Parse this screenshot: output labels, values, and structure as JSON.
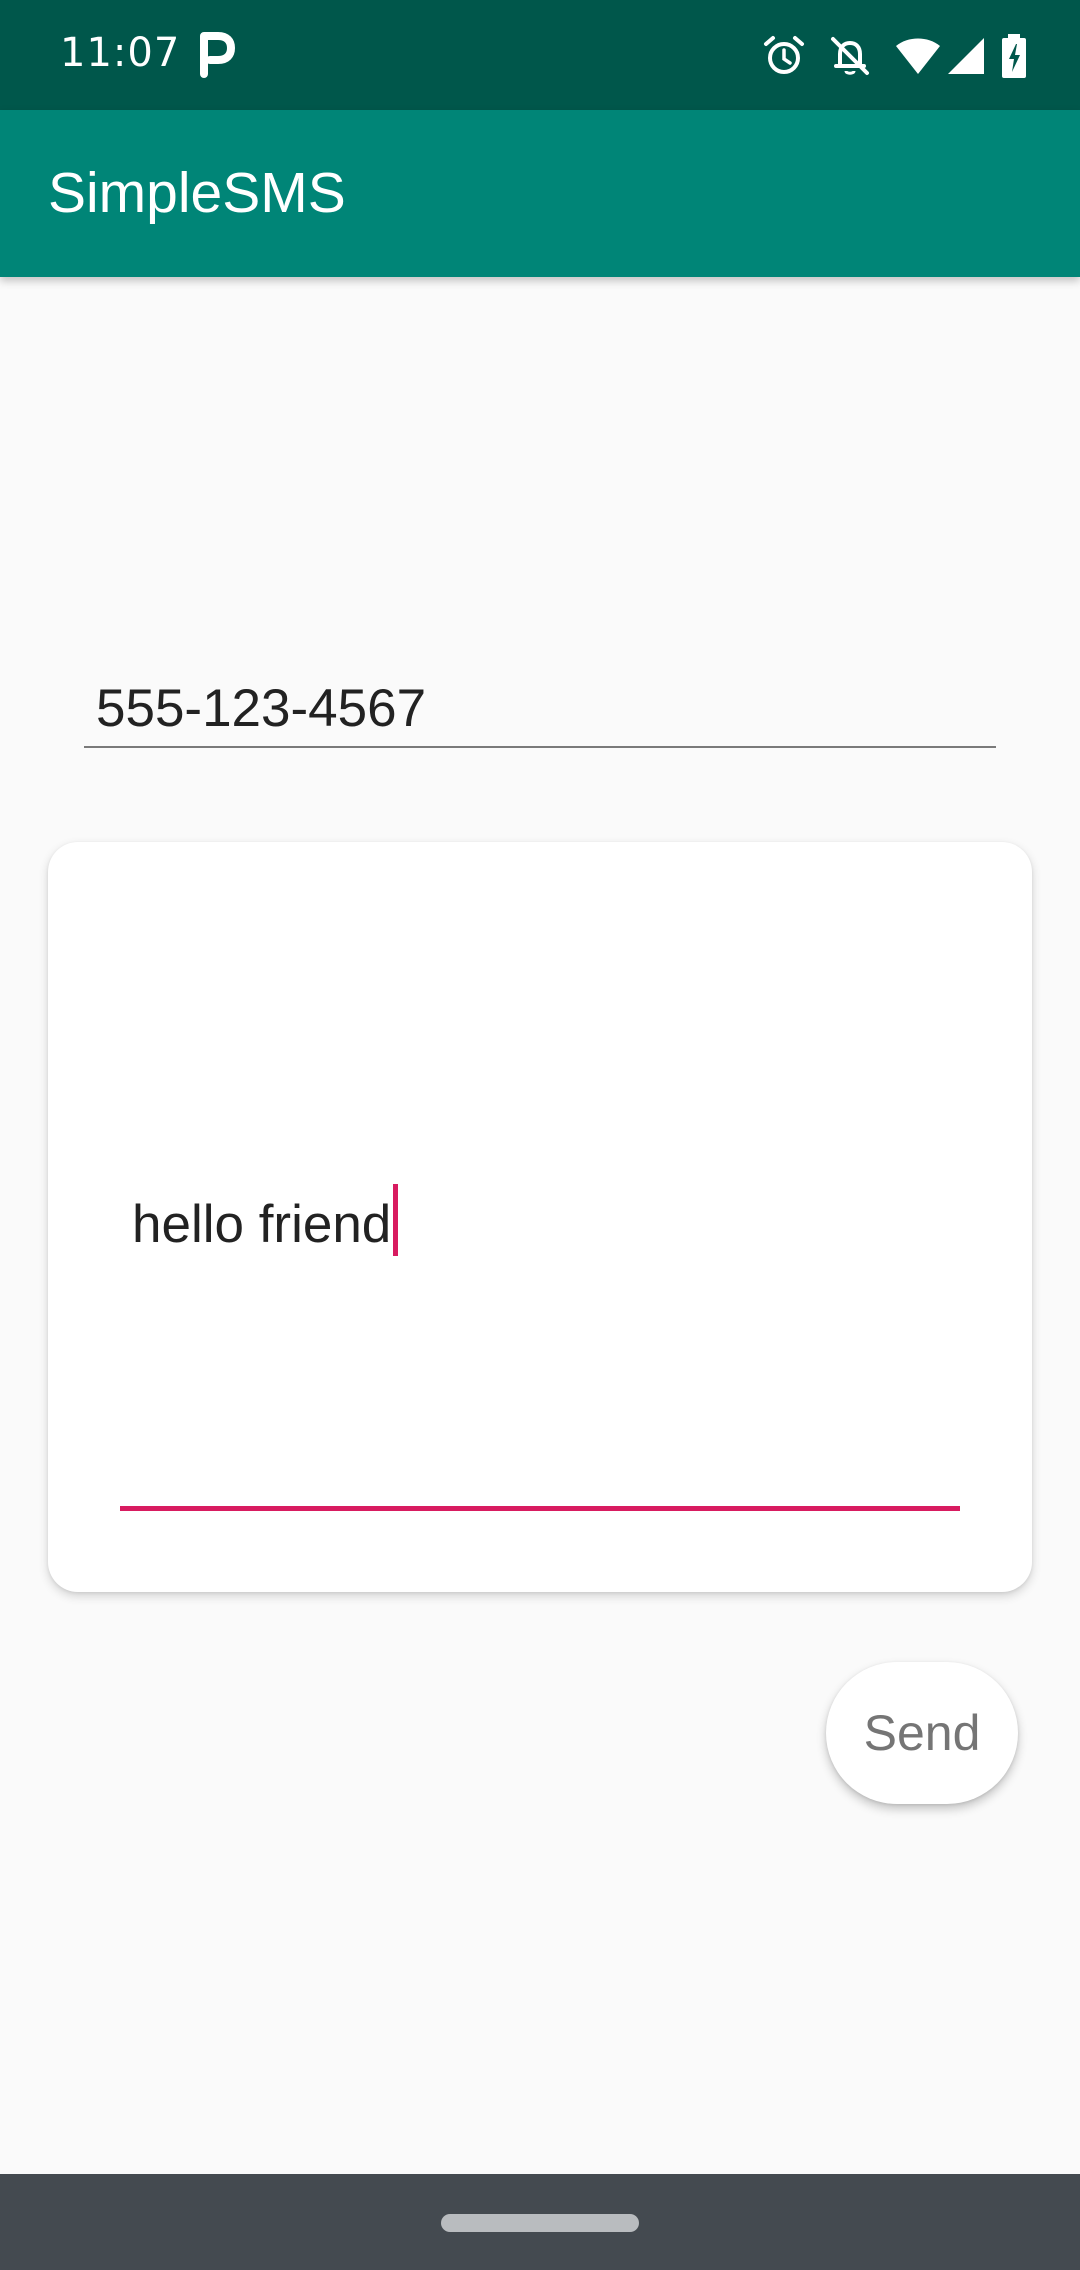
{
  "status_bar": {
    "time": "11:07",
    "icons": [
      "parking-icon",
      "alarm-icon",
      "notifications-off-icon",
      "wifi-icon",
      "cellular-signal-icon",
      "battery-icon"
    ]
  },
  "app_bar": {
    "title": "SimpleSMS"
  },
  "form": {
    "phone_value": "555-123-4567",
    "message_value": "hello friend",
    "send_label": "Send"
  },
  "colors": {
    "status_bar": "#00574b",
    "app_bar": "#008577",
    "accent": "#d81b60",
    "background": "#fafafa",
    "nav_bar": "#444a50"
  }
}
